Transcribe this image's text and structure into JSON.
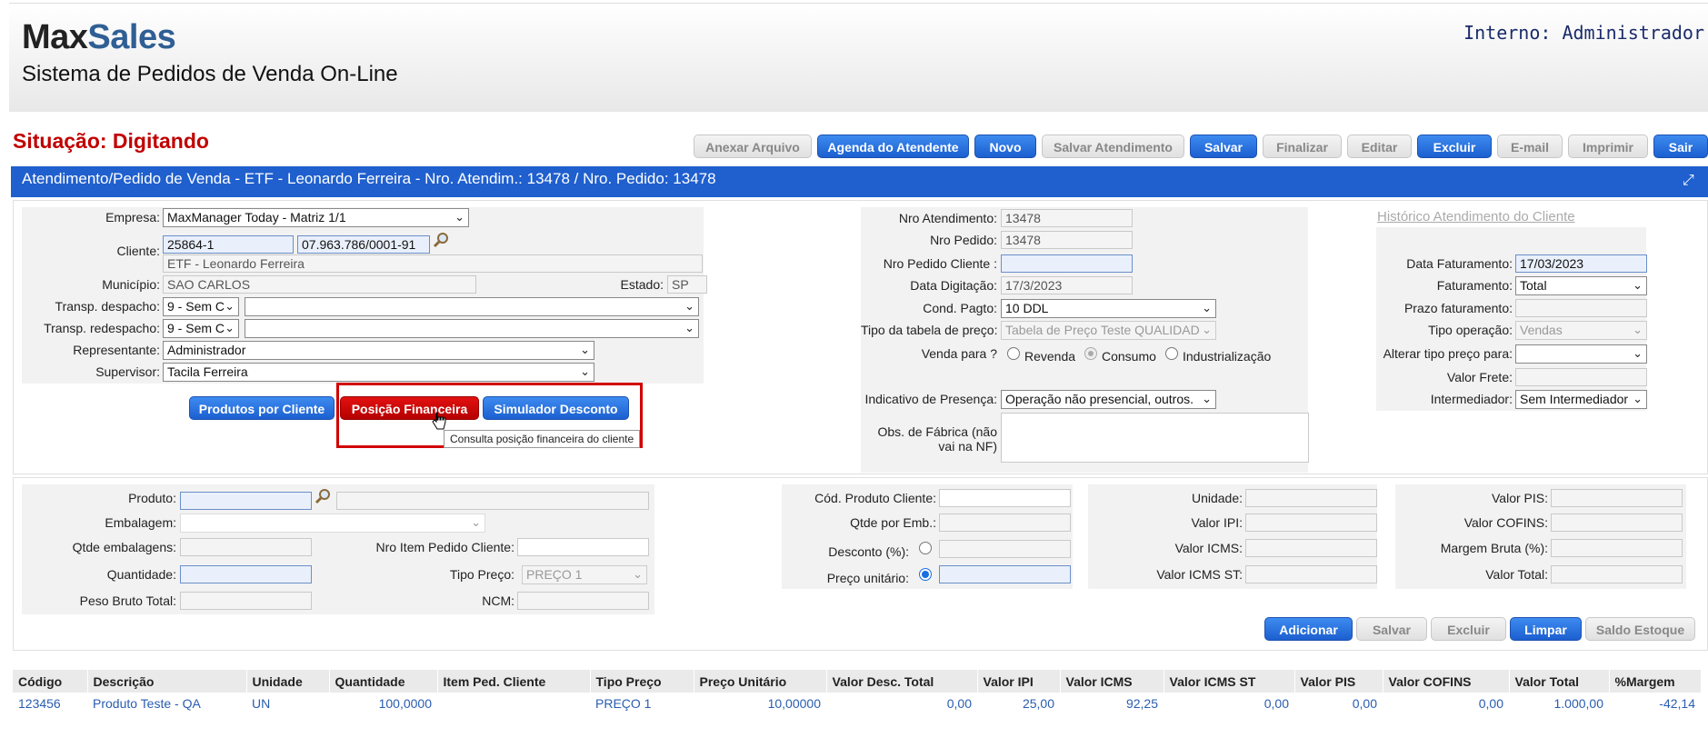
{
  "header": {
    "logo_max": "Max",
    "logo_sales": "Sales",
    "system_title": "Sistema de Pedidos de Venda On-Line",
    "user": "Interno: Administrador"
  },
  "situacao": "Situação:  Digitando",
  "toolbar": {
    "anexar": "Anexar Arquivo",
    "agenda": "Agenda do Atendente",
    "novo": "Novo",
    "salvar_atendimento": "Salvar Atendimento",
    "salvar": "Salvar",
    "finalizar": "Finalizar",
    "editar": "Editar",
    "excluir": "Excluir",
    "email": "E-mail",
    "imprimir": "Imprimir",
    "sair": "Sair"
  },
  "title_bar": "Atendimento/Pedido de Venda - ETF - Leonardo Ferreira - Nro. Atendim.: 13478 / Nro. Pedido: 13478",
  "left_form": {
    "empresa_label": "Empresa:",
    "empresa_value": "MaxManager Today - Matriz 1/1",
    "cliente_label": "Cliente:",
    "cliente_code": "25864-1",
    "cliente_cnpj": "07.963.786/0001-91",
    "cliente_name": "ETF - Leonardo Ferreira",
    "municipio_label": "Município:",
    "municipio_value": "SAO CARLOS",
    "estado_label": "Estado:",
    "estado_value": "SP",
    "transp_despacho_label": "Transp. despacho:",
    "transp_despacho_value": "9 - Sem C",
    "transp_redespacho_label": "Transp. redespacho:",
    "transp_redespacho_value": "9 - Sem C",
    "representante_label": "Representante:",
    "representante_value": "Administrador",
    "supervisor_label": "Supervisor:",
    "supervisor_value": "Tacila Ferreira",
    "btn_produtos": "Produtos por Cliente",
    "btn_posicao": "Posição Financeira",
    "btn_simulador": "Simulador Desconto",
    "tooltip": "Consulta posição financeira do cliente"
  },
  "mid_form": {
    "nro_atendimento_label": "Nro Atendimento:",
    "nro_atendimento_value": "13478",
    "nro_pedido_label": "Nro Pedido:",
    "nro_pedido_value": "13478",
    "nro_pedido_cliente_label": "Nro Pedido Cliente :",
    "data_digitacao_label": "Data Digitação:",
    "data_digitacao_value": "17/3/2023",
    "cond_pagto_label": "Cond. Pagto:",
    "cond_pagto_value": "10 DDL",
    "tipo_tabela_label": "Tipo da tabela de preço:",
    "tipo_tabela_value": "Tabela de Preço Teste QUALIDAD",
    "venda_para_label": "Venda para ?",
    "revenda": "Revenda",
    "consumo": "Consumo",
    "industrializacao": "Industrialização",
    "indicativo_label": "Indicativo de Presença:",
    "indicativo_value": "Operação não presencial, outros.",
    "obs_label": "Obs. de Fábrica (não vai na NF)"
  },
  "right_form": {
    "historico": "Histórico Atendimento do Cliente",
    "data_faturamento_label": "Data Faturamento:",
    "data_faturamento_value": "17/03/2023",
    "faturamento_label": "Faturamento:",
    "faturamento_value": "Total",
    "prazo_label": "Prazo faturamento:",
    "tipo_operacao_label": "Tipo operação:",
    "tipo_operacao_value": "Vendas",
    "alterar_tipo_label": "Alterar tipo preço para:",
    "valor_frete_label": "Valor Frete:",
    "intermediador_label": "Intermediador:",
    "intermediador_value": "Sem Intermediador"
  },
  "product_form": {
    "produto_label": "Produto:",
    "embalagem_label": "Embalagem:",
    "qtde_embalagens_label": "Qtde embalagens:",
    "nro_item_label": "Nro Item Pedido Cliente:",
    "quantidade_label": "Quantidade:",
    "tipo_preco_label": "Tipo Preço:",
    "tipo_preco_value": "PREÇO 1",
    "peso_label": "Peso Bruto Total:",
    "ncm_label": "NCM:",
    "cod_produto_cliente_label": "Cód. Produto Cliente:",
    "qtde_por_emb_label": "Qtde por Emb.:",
    "desconto_label": "Desconto (%):",
    "preco_unitario_label": "Preço unitário:",
    "unidade_label": "Unidade:",
    "valor_ipi_label": "Valor IPI:",
    "valor_icms_label": "Valor ICMS:",
    "valor_icms_st_label": "Valor ICMS ST:",
    "valor_pis_label": "Valor PIS:",
    "valor_cofins_label": "Valor COFINS:",
    "margem_label": "Margem Bruta (%):",
    "valor_total_label": "Valor Total:"
  },
  "item_buttons": {
    "adicionar": "Adicionar",
    "salvar": "Salvar",
    "excluir": "Excluir",
    "limpar": "Limpar",
    "saldo": "Saldo Estoque"
  },
  "items_table": {
    "headers": [
      "Código",
      "Descrição",
      "Unidade",
      "Quantidade",
      "Item Ped. Cliente",
      "Tipo Preço",
      "Preço Unitário",
      "Valor Desc. Total",
      "Valor IPI",
      "Valor ICMS",
      "Valor ICMS ST",
      "Valor PIS",
      "Valor COFINS",
      "Valor Total",
      "%Margem"
    ],
    "rows": [
      [
        "123456",
        "Produto Teste - QA",
        "UN",
        "100,0000",
        "",
        "PREÇO 1",
        "10,00000",
        "0,00",
        "25,00",
        "92,25",
        "0,00",
        "0,00",
        "0,00",
        "1.000,00",
        "-42,14"
      ]
    ]
  }
}
